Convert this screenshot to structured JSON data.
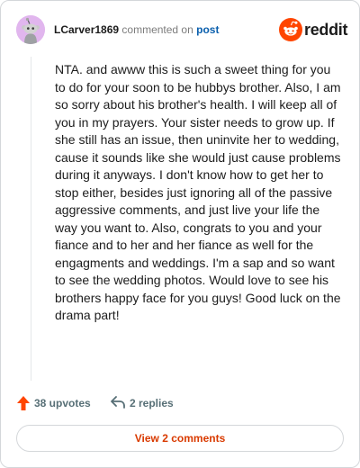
{
  "comment": {
    "username": "LCarver1869",
    "action_text": "commented on",
    "target_text": "post",
    "body": "NTA. and awww this is such a sweet thing for you to do for your soon to be hubbys brother. Also, I am so sorry about his brother's health. I will keep all of you in my prayers. Your sister needs to grow up. If she still has an issue, then uninvite her to wedding, cause it sounds like she would just cause problems during it anyways. I don't know how to get her to stop either, besides just ignoring all of the passive aggressive comments, and just live your life the way you want to. Also, congrats to you and your fiance and to her and her fiance as well for the engagments and weddings. I'm a sap and so want to see the wedding photos. Would love to see his brothers happy face for you guys! Good luck on the drama part!"
  },
  "brand": {
    "name": "reddit",
    "icon": "reddit-logo-icon",
    "color": "#ff4500"
  },
  "actions": {
    "upvotes_label": "38 upvotes",
    "upvote_icon": "upvote-arrow-icon",
    "upvote_color": "#ff4500",
    "replies_label": "2 replies",
    "reply_icon": "reply-arrow-icon"
  },
  "footer": {
    "view_comments_label": "View 2 comments",
    "accent": "#d93a00"
  },
  "avatar": {
    "icon": "snoo-avatar-icon",
    "bg": "#e1b6ee"
  }
}
